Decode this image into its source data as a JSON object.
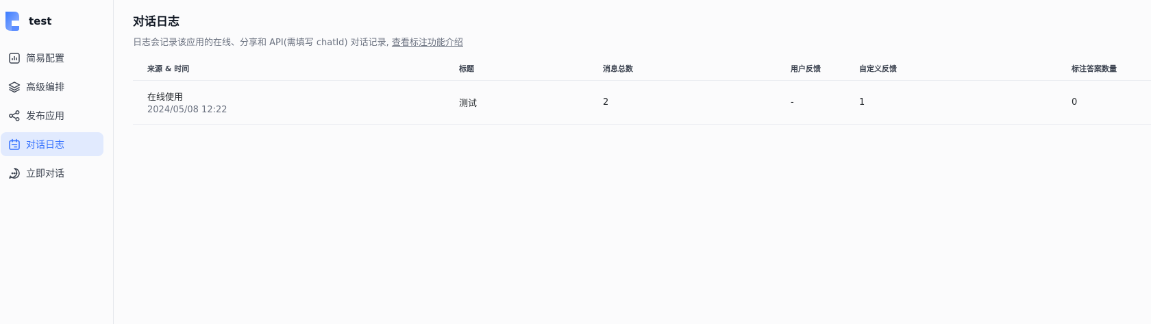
{
  "app": {
    "name": "test"
  },
  "sidebar": {
    "items": [
      {
        "label": "简易配置",
        "icon": "bar-chart-icon",
        "active": false
      },
      {
        "label": "高级编排",
        "icon": "layers-icon",
        "active": false
      },
      {
        "label": "发布应用",
        "icon": "share-icon",
        "active": false
      },
      {
        "label": "对话日志",
        "icon": "calendar-log-icon",
        "active": true
      },
      {
        "label": "立即对话",
        "icon": "chat-bubble-icon",
        "active": false
      }
    ]
  },
  "page": {
    "title": "对话日志",
    "description": "日志会记录该应用的在线、分享和 API(需填写 chatId) 对话记录,",
    "link": "查看标注功能介绍"
  },
  "table": {
    "headers": [
      "来源 & 时间",
      "标题",
      "消息总数",
      "用户反馈",
      "自定义反馈",
      "标注答案数量"
    ],
    "rows": [
      {
        "source": "在线使用",
        "time": "2024/05/08 12:22",
        "title": "测试",
        "message_count": "2",
        "user_feedback": "-",
        "custom_feedback": "1",
        "annotation_count": "0"
      }
    ]
  },
  "colors": {
    "accent": "#3370ff",
    "active_bg": "#e1eafe"
  }
}
